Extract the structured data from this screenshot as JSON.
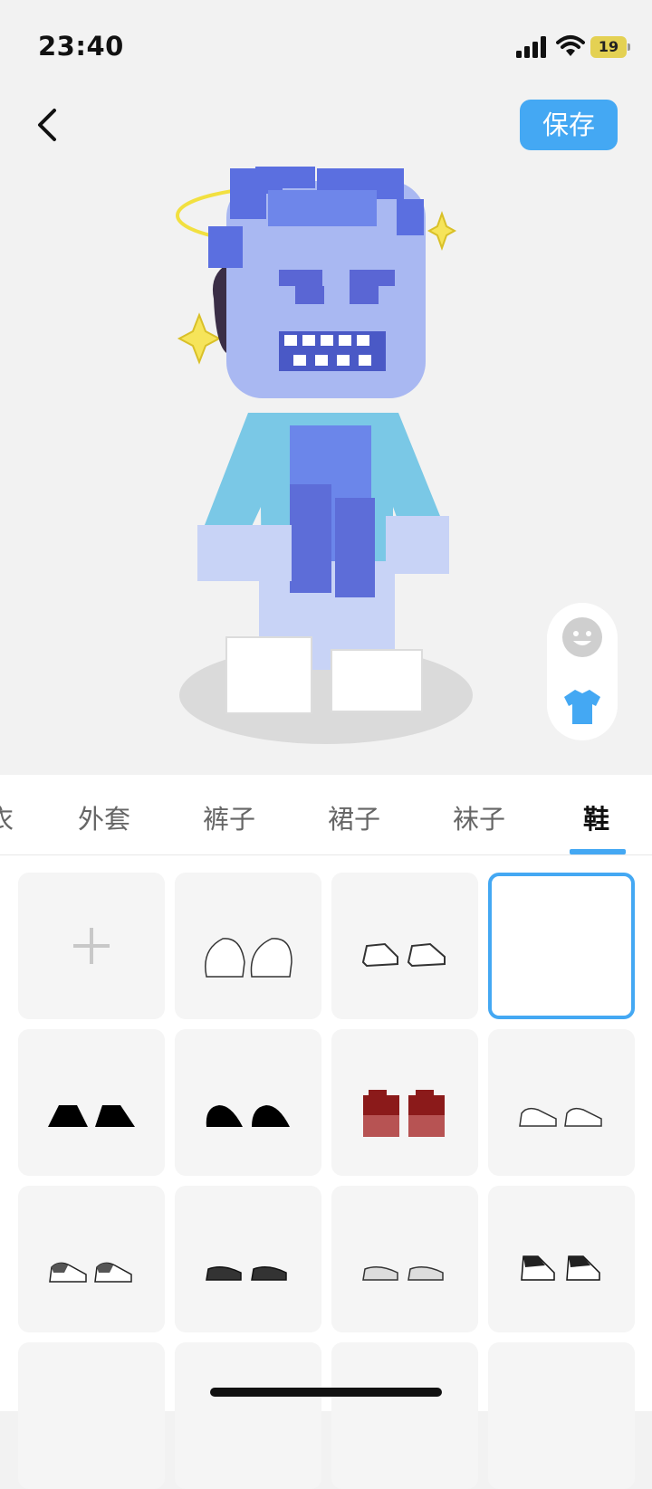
{
  "status": {
    "time": "23:40",
    "battery": "19"
  },
  "header": {
    "save_label": "保存"
  },
  "tabs": [
    {
      "label": "衣"
    },
    {
      "label": "外套"
    },
    {
      "label": "裤子"
    },
    {
      "label": "裙子"
    },
    {
      "label": "袜子"
    },
    {
      "label": "鞋",
      "active": true
    }
  ],
  "grid": {
    "items": [
      {
        "name": "add-item",
        "icon": "plus-icon"
      },
      {
        "name": "bare-feet",
        "icon": "bare-feet-icon"
      },
      {
        "name": "white-socks-shoes",
        "icon": "white-shoes-icon"
      },
      {
        "name": "none-selected",
        "icon": "empty",
        "selected": true
      },
      {
        "name": "black-flat-shoes",
        "icon": "black-shoes-icon"
      },
      {
        "name": "black-round-shoes",
        "icon": "black-round-shoes-icon"
      },
      {
        "name": "red-pixel-shoes",
        "icon": "red-pixel-shoes-icon"
      },
      {
        "name": "white-sneakers",
        "icon": "white-sneakers-icon"
      },
      {
        "name": "gray-sneakers",
        "icon": "gray-sneakers-icon"
      },
      {
        "name": "dark-slipons",
        "icon": "dark-slipons-icon"
      },
      {
        "name": "light-slipons",
        "icon": "light-slipons-icon"
      },
      {
        "name": "black-high-tops",
        "icon": "black-hightops-icon"
      }
    ]
  },
  "colors": {
    "accent": "#44a8f3",
    "background": "#f2f2f2"
  }
}
